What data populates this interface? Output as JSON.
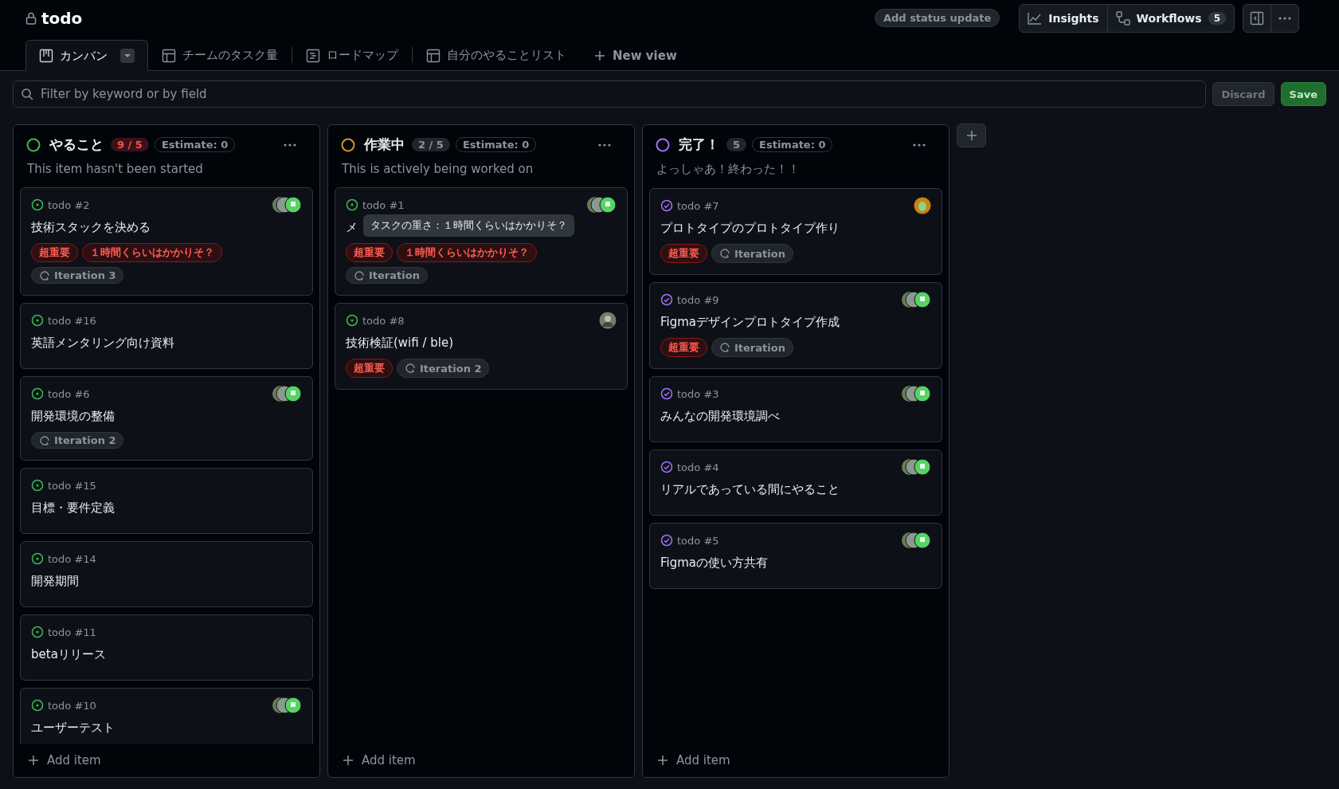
{
  "header": {
    "title": "todo",
    "status_button": "Add status update",
    "insights": "Insights",
    "workflows": "Workflows",
    "workflows_count": "5"
  },
  "tabs": [
    {
      "label": "カンバン",
      "kind": "board",
      "selected": true
    },
    {
      "label": "チームのタスク量",
      "kind": "table",
      "selected": false
    },
    {
      "label": "ロードマップ",
      "kind": "roadmap",
      "selected": false
    },
    {
      "label": "自分のやることリスト",
      "kind": "table",
      "selected": false
    }
  ],
  "new_view": "New view",
  "filter": {
    "placeholder": "Filter by keyword or by field",
    "discard": "Discard",
    "save": "Save"
  },
  "columns": [
    {
      "name": "やること",
      "color": "#3fb950",
      "count": "9 / 5",
      "over_limit": true,
      "estimate": "Estimate: 0",
      "description": "This item hasn't been started",
      "add_item": "Add item",
      "cards": [
        {
          "number": "todo #2",
          "done": false,
          "title": "技術スタックを決める",
          "avatar": {
            "kind": "pair"
          },
          "labels": [
            {
              "text": "超重要",
              "kind": "danger"
            },
            {
              "text": "１時間くらいはかかりそ？",
              "kind": "danger"
            },
            {
              "text": "Iteration 3",
              "kind": "iteration"
            }
          ]
        },
        {
          "number": "todo #16",
          "done": false,
          "title": "英語メンタリング向け資料"
        },
        {
          "number": "todo #6",
          "done": false,
          "title": "開発環境の整備",
          "avatar": {
            "kind": "pair"
          },
          "labels": [
            {
              "text": "Iteration 2",
              "kind": "iteration"
            }
          ]
        },
        {
          "number": "todo #15",
          "done": false,
          "title": "目標・要件定義"
        },
        {
          "number": "todo #14",
          "done": false,
          "title": "開発期間"
        },
        {
          "number": "todo #11",
          "done": false,
          "title": "betaリリース"
        },
        {
          "number": "todo #10",
          "done": false,
          "title": "ユーザーテスト",
          "avatar": {
            "kind": "pair"
          }
        }
      ]
    },
    {
      "name": "作業中",
      "color": "#d29922",
      "count": "2 / 5",
      "over_limit": false,
      "estimate": "Estimate: 0",
      "description": "This is actively being worked on",
      "add_item": "Add item",
      "cards": [
        {
          "number": "todo #1",
          "done": false,
          "title": "メ",
          "avatar": {
            "kind": "pair"
          },
          "tooltip": "タスクの重さ：１時間くらいはかかりそ？",
          "labels": [
            {
              "text": "超重要",
              "kind": "danger"
            },
            {
              "text": "１時間くらいはかかりそ？",
              "kind": "danger"
            },
            {
              "text": "Iteration",
              "kind": "iteration"
            }
          ]
        },
        {
          "number": "todo #8",
          "done": false,
          "title": "技術検証(wifi / ble)",
          "avatar": {
            "kind": "photo"
          },
          "labels": [
            {
              "text": "超重要",
              "kind": "danger"
            },
            {
              "text": "Iteration 2",
              "kind": "iteration"
            }
          ]
        }
      ]
    },
    {
      "name": "完了！",
      "color": "#a371f7",
      "count": "5",
      "over_limit": false,
      "estimate": "Estimate: 0",
      "description": "よっしゃあ！終わった！！",
      "add_item": "Add item",
      "cards": [
        {
          "number": "todo #7",
          "done": true,
          "title": "プロトタイプのプロトタイプ作り",
          "avatar": {
            "kind": "bot"
          },
          "labels": [
            {
              "text": "超重要",
              "kind": "danger"
            },
            {
              "text": "Iteration",
              "kind": "iteration"
            }
          ]
        },
        {
          "number": "todo #9",
          "done": true,
          "title": "Figmaデザインプロトタイプ作成",
          "avatar": {
            "kind": "pair"
          },
          "labels": [
            {
              "text": "超重要",
              "kind": "danger"
            },
            {
              "text": "Iteration",
              "kind": "iteration"
            }
          ]
        },
        {
          "number": "todo #3",
          "done": true,
          "title": "みんなの開発環境調べ",
          "avatar": {
            "kind": "pair"
          }
        },
        {
          "number": "todo #4",
          "done": true,
          "title": "リアルであっている間にやること",
          "avatar": {
            "kind": "pair"
          }
        },
        {
          "number": "todo #5",
          "done": true,
          "title": "Figmaの使い方共有",
          "avatar": {
            "kind": "pair"
          }
        }
      ]
    }
  ]
}
